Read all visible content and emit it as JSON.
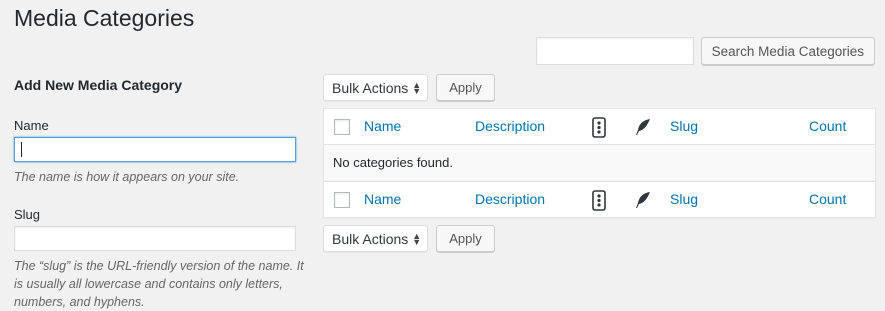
{
  "page": {
    "title": "Media Categories"
  },
  "search": {
    "placeholder": "",
    "button_label": "Search Media Categories"
  },
  "add_form": {
    "heading": "Add New Media Category",
    "name_label": "Name",
    "name_value": "",
    "name_help": "The name is how it appears on your site.",
    "slug_label": "Slug",
    "slug_value": "",
    "slug_help": "The “slug” is the URL-friendly version of the name. It is usually all lowercase and contains only letters, numbers, and hyphens."
  },
  "tablenav_top": {
    "bulk_actions": "Bulk Actions",
    "apply": "Apply"
  },
  "tablenav_bottom": {
    "bulk_actions": "Bulk Actions",
    "apply": "Apply"
  },
  "table": {
    "columns": [
      "Name",
      "Description",
      "Slug",
      "Count"
    ],
    "icons": [
      "order-icon",
      "feather-icon"
    ],
    "empty_message": "No categories found."
  },
  "colors": {
    "link": "#0073aa",
    "background": "#f1f1f1",
    "text": "#23282d"
  }
}
